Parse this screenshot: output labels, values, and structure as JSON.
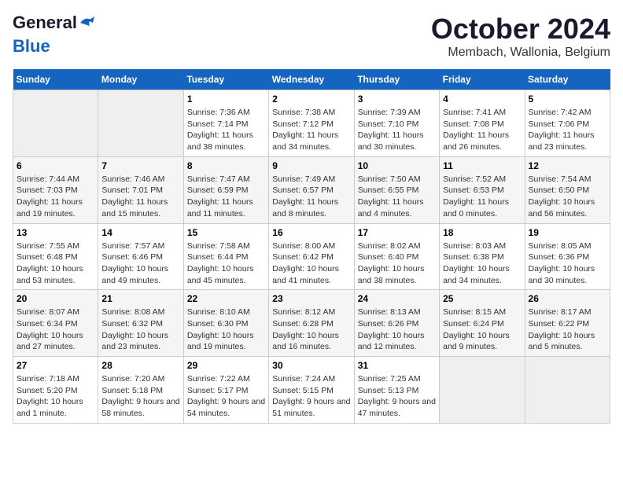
{
  "header": {
    "logo_general": "General",
    "logo_blue": "Blue",
    "month_title": "October 2024",
    "location": "Membach, Wallonia, Belgium"
  },
  "days_of_week": [
    "Sunday",
    "Monday",
    "Tuesday",
    "Wednesday",
    "Thursday",
    "Friday",
    "Saturday"
  ],
  "weeks": [
    [
      {
        "day": "",
        "sunrise": "",
        "sunset": "",
        "daylight": ""
      },
      {
        "day": "",
        "sunrise": "",
        "sunset": "",
        "daylight": ""
      },
      {
        "day": "1",
        "sunrise": "Sunrise: 7:36 AM",
        "sunset": "Sunset: 7:14 PM",
        "daylight": "Daylight: 11 hours and 38 minutes."
      },
      {
        "day": "2",
        "sunrise": "Sunrise: 7:38 AM",
        "sunset": "Sunset: 7:12 PM",
        "daylight": "Daylight: 11 hours and 34 minutes."
      },
      {
        "day": "3",
        "sunrise": "Sunrise: 7:39 AM",
        "sunset": "Sunset: 7:10 PM",
        "daylight": "Daylight: 11 hours and 30 minutes."
      },
      {
        "day": "4",
        "sunrise": "Sunrise: 7:41 AM",
        "sunset": "Sunset: 7:08 PM",
        "daylight": "Daylight: 11 hours and 26 minutes."
      },
      {
        "day": "5",
        "sunrise": "Sunrise: 7:42 AM",
        "sunset": "Sunset: 7:06 PM",
        "daylight": "Daylight: 11 hours and 23 minutes."
      }
    ],
    [
      {
        "day": "6",
        "sunrise": "Sunrise: 7:44 AM",
        "sunset": "Sunset: 7:03 PM",
        "daylight": "Daylight: 11 hours and 19 minutes."
      },
      {
        "day": "7",
        "sunrise": "Sunrise: 7:46 AM",
        "sunset": "Sunset: 7:01 PM",
        "daylight": "Daylight: 11 hours and 15 minutes."
      },
      {
        "day": "8",
        "sunrise": "Sunrise: 7:47 AM",
        "sunset": "Sunset: 6:59 PM",
        "daylight": "Daylight: 11 hours and 11 minutes."
      },
      {
        "day": "9",
        "sunrise": "Sunrise: 7:49 AM",
        "sunset": "Sunset: 6:57 PM",
        "daylight": "Daylight: 11 hours and 8 minutes."
      },
      {
        "day": "10",
        "sunrise": "Sunrise: 7:50 AM",
        "sunset": "Sunset: 6:55 PM",
        "daylight": "Daylight: 11 hours and 4 minutes."
      },
      {
        "day": "11",
        "sunrise": "Sunrise: 7:52 AM",
        "sunset": "Sunset: 6:53 PM",
        "daylight": "Daylight: 11 hours and 0 minutes."
      },
      {
        "day": "12",
        "sunrise": "Sunrise: 7:54 AM",
        "sunset": "Sunset: 6:50 PM",
        "daylight": "Daylight: 10 hours and 56 minutes."
      }
    ],
    [
      {
        "day": "13",
        "sunrise": "Sunrise: 7:55 AM",
        "sunset": "Sunset: 6:48 PM",
        "daylight": "Daylight: 10 hours and 53 minutes."
      },
      {
        "day": "14",
        "sunrise": "Sunrise: 7:57 AM",
        "sunset": "Sunset: 6:46 PM",
        "daylight": "Daylight: 10 hours and 49 minutes."
      },
      {
        "day": "15",
        "sunrise": "Sunrise: 7:58 AM",
        "sunset": "Sunset: 6:44 PM",
        "daylight": "Daylight: 10 hours and 45 minutes."
      },
      {
        "day": "16",
        "sunrise": "Sunrise: 8:00 AM",
        "sunset": "Sunset: 6:42 PM",
        "daylight": "Daylight: 10 hours and 41 minutes."
      },
      {
        "day": "17",
        "sunrise": "Sunrise: 8:02 AM",
        "sunset": "Sunset: 6:40 PM",
        "daylight": "Daylight: 10 hours and 38 minutes."
      },
      {
        "day": "18",
        "sunrise": "Sunrise: 8:03 AM",
        "sunset": "Sunset: 6:38 PM",
        "daylight": "Daylight: 10 hours and 34 minutes."
      },
      {
        "day": "19",
        "sunrise": "Sunrise: 8:05 AM",
        "sunset": "Sunset: 6:36 PM",
        "daylight": "Daylight: 10 hours and 30 minutes."
      }
    ],
    [
      {
        "day": "20",
        "sunrise": "Sunrise: 8:07 AM",
        "sunset": "Sunset: 6:34 PM",
        "daylight": "Daylight: 10 hours and 27 minutes."
      },
      {
        "day": "21",
        "sunrise": "Sunrise: 8:08 AM",
        "sunset": "Sunset: 6:32 PM",
        "daylight": "Daylight: 10 hours and 23 minutes."
      },
      {
        "day": "22",
        "sunrise": "Sunrise: 8:10 AM",
        "sunset": "Sunset: 6:30 PM",
        "daylight": "Daylight: 10 hours and 19 minutes."
      },
      {
        "day": "23",
        "sunrise": "Sunrise: 8:12 AM",
        "sunset": "Sunset: 6:28 PM",
        "daylight": "Daylight: 10 hours and 16 minutes."
      },
      {
        "day": "24",
        "sunrise": "Sunrise: 8:13 AM",
        "sunset": "Sunset: 6:26 PM",
        "daylight": "Daylight: 10 hours and 12 minutes."
      },
      {
        "day": "25",
        "sunrise": "Sunrise: 8:15 AM",
        "sunset": "Sunset: 6:24 PM",
        "daylight": "Daylight: 10 hours and 9 minutes."
      },
      {
        "day": "26",
        "sunrise": "Sunrise: 8:17 AM",
        "sunset": "Sunset: 6:22 PM",
        "daylight": "Daylight: 10 hours and 5 minutes."
      }
    ],
    [
      {
        "day": "27",
        "sunrise": "Sunrise: 7:18 AM",
        "sunset": "Sunset: 5:20 PM",
        "daylight": "Daylight: 10 hours and 1 minute."
      },
      {
        "day": "28",
        "sunrise": "Sunrise: 7:20 AM",
        "sunset": "Sunset: 5:18 PM",
        "daylight": "Daylight: 9 hours and 58 minutes."
      },
      {
        "day": "29",
        "sunrise": "Sunrise: 7:22 AM",
        "sunset": "Sunset: 5:17 PM",
        "daylight": "Daylight: 9 hours and 54 minutes."
      },
      {
        "day": "30",
        "sunrise": "Sunrise: 7:24 AM",
        "sunset": "Sunset: 5:15 PM",
        "daylight": "Daylight: 9 hours and 51 minutes."
      },
      {
        "day": "31",
        "sunrise": "Sunrise: 7:25 AM",
        "sunset": "Sunset: 5:13 PM",
        "daylight": "Daylight: 9 hours and 47 minutes."
      },
      {
        "day": "",
        "sunrise": "",
        "sunset": "",
        "daylight": ""
      },
      {
        "day": "",
        "sunrise": "",
        "sunset": "",
        "daylight": ""
      }
    ]
  ]
}
